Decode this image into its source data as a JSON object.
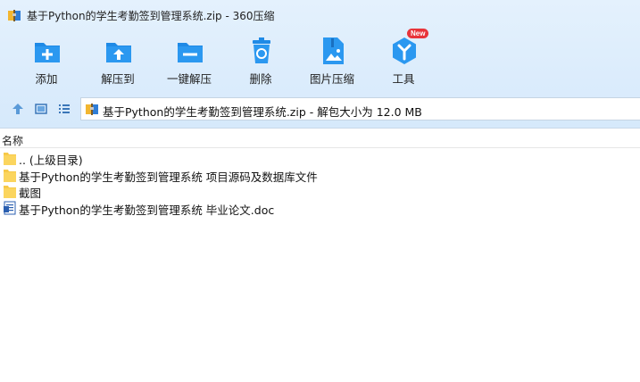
{
  "window": {
    "title": "基于Python的学生考勤签到管理系统.zip - 360压缩"
  },
  "toolbar": {
    "items": [
      {
        "label": "添加",
        "icon": "add-box-icon"
      },
      {
        "label": "解压到",
        "icon": "extract-to-icon"
      },
      {
        "label": "一键解压",
        "icon": "one-click-extract-icon"
      },
      {
        "label": "删除",
        "icon": "trash-icon"
      },
      {
        "label": "图片压缩",
        "icon": "image-compress-icon"
      },
      {
        "label": "工具",
        "icon": "tools-icon",
        "badge": "New"
      }
    ]
  },
  "navbar": {
    "path": "基于Python的学生考勤签到管理系统.zip - 解包大小为 12.0 MB"
  },
  "list": {
    "column_name": "名称",
    "rows": [
      {
        "name": ".. (上级目录)",
        "type": "folder"
      },
      {
        "name": "基于Python的学生考勤签到管理系统 项目源码及数据库文件",
        "type": "folder"
      },
      {
        "name": "截图",
        "type": "folder"
      },
      {
        "name": "基于Python的学生考勤签到管理系统 毕业论文.doc",
        "type": "doc"
      }
    ]
  },
  "colors": {
    "accent": "#1f8ae6",
    "folder": "#f7c948",
    "badge": "#e8343a"
  }
}
